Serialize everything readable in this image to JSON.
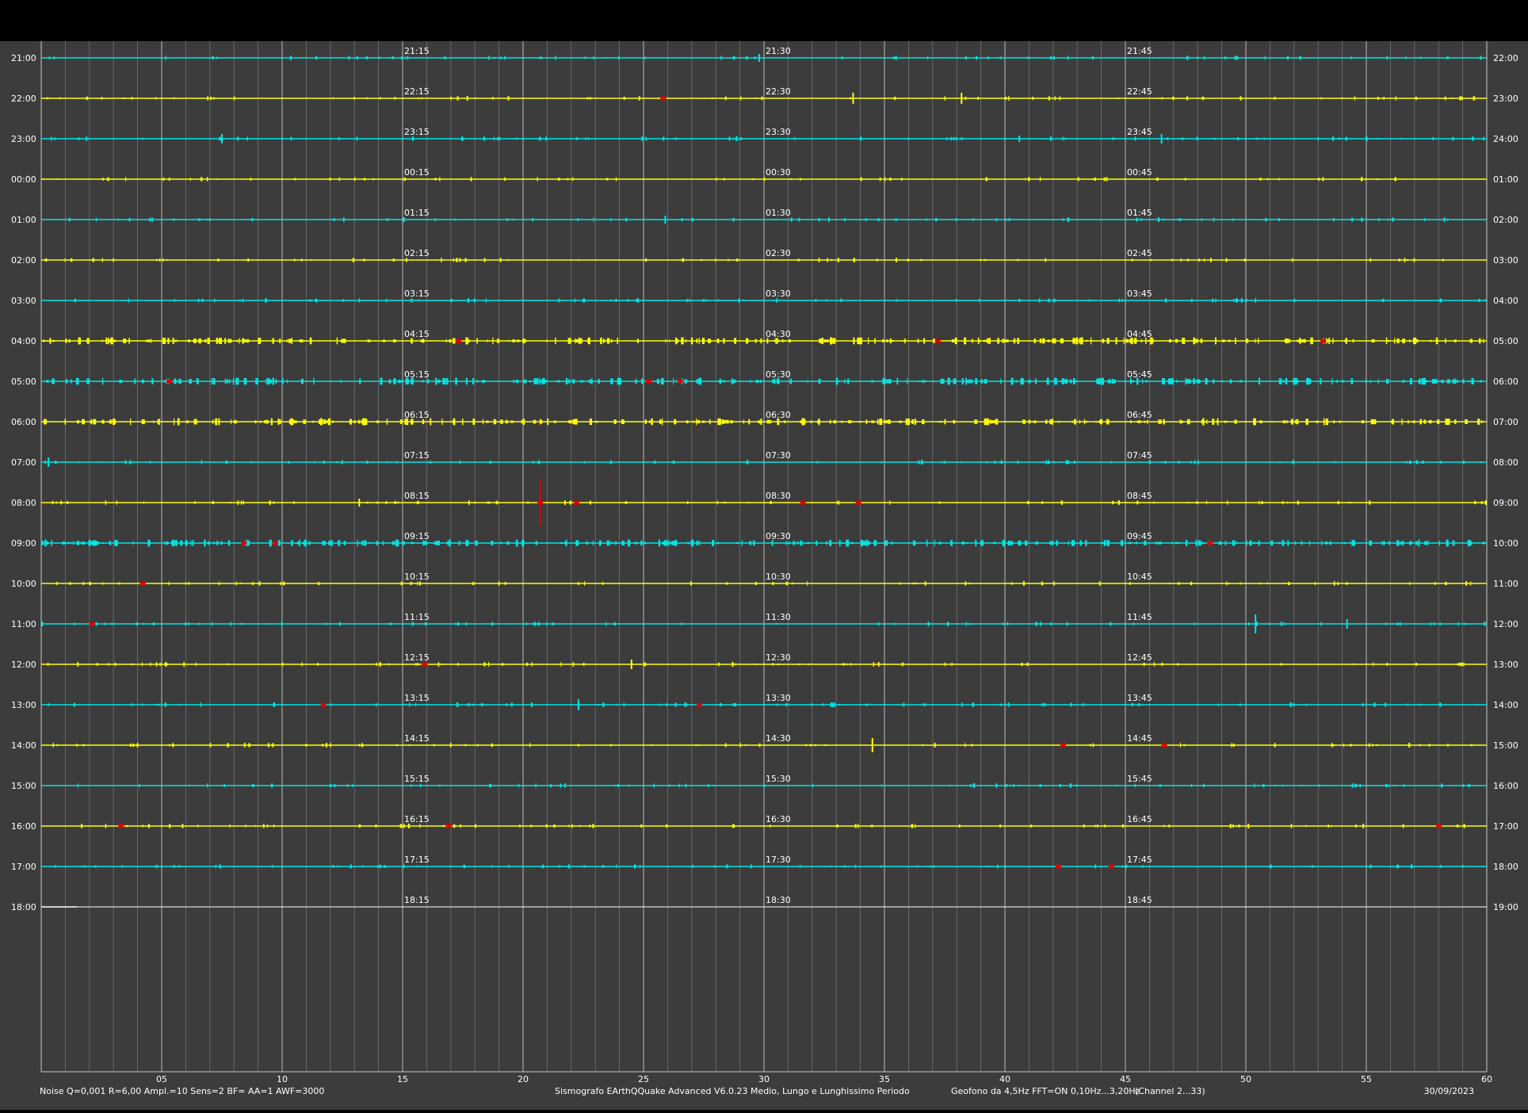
{
  "chart_data": {
    "type": "line",
    "title": "",
    "x_range": [
      0,
      60
    ],
    "x_ticks": [
      "05",
      "10",
      "15",
      "20",
      "25",
      "30",
      "35",
      "40",
      "45",
      "50",
      "55",
      "60"
    ],
    "colors": {
      "background": "#3c3c3c",
      "trace_cyan": "#00e5e5",
      "trace_yellow": "#ffff00",
      "event_red": "#e00000",
      "grid_major": "#c8c8c8",
      "grid_minor": "#8a8a8a",
      "text": "#ffffff"
    },
    "rows": [
      {
        "left": "21:00",
        "right": "22:00",
        "m15": "21:15",
        "m30": "21:30",
        "m45": "21:45",
        "color": "cyan"
      },
      {
        "left": "22:00",
        "right": "23:00",
        "m15": "22:15",
        "m30": "22:30",
        "m45": "22:45",
        "color": "yellow"
      },
      {
        "left": "23:00",
        "right": "24:00",
        "m15": "23:15",
        "m30": "23:30",
        "m45": "23:45",
        "color": "cyan"
      },
      {
        "left": "00:00",
        "right": "01:00",
        "m15": "00:15",
        "m30": "00:30",
        "m45": "00:45",
        "color": "yellow"
      },
      {
        "left": "01:00",
        "right": "02:00",
        "m15": "01:15",
        "m30": "01:30",
        "m45": "01:45",
        "color": "cyan"
      },
      {
        "left": "02:00",
        "right": "03:00",
        "m15": "02:15",
        "m30": "02:30",
        "m45": "02:45",
        "color": "yellow"
      },
      {
        "left": "03:00",
        "right": "04:00",
        "m15": "03:15",
        "m30": "03:30",
        "m45": "03:45",
        "color": "cyan"
      },
      {
        "left": "04:00",
        "right": "05:00",
        "m15": "04:15",
        "m30": "04:30",
        "m45": "04:45",
        "color": "yellow"
      },
      {
        "left": "05:00",
        "right": "06:00",
        "m15": "05:15",
        "m30": "05:30",
        "m45": "05:45",
        "color": "cyan"
      },
      {
        "left": "06:00",
        "right": "07:00",
        "m15": "06:15",
        "m30": "06:30",
        "m45": "06:45",
        "color": "yellow"
      },
      {
        "left": "07:00",
        "right": "08:00",
        "m15": "07:15",
        "m30": "07:30",
        "m45": "07:45",
        "color": "cyan"
      },
      {
        "left": "08:00",
        "right": "09:00",
        "m15": "08:15",
        "m30": "08:30",
        "m45": "08:45",
        "color": "yellow"
      },
      {
        "left": "09:00",
        "right": "10:00",
        "m15": "09:15",
        "m30": "09:30",
        "m45": "09:45",
        "color": "cyan"
      },
      {
        "left": "10:00",
        "right": "11:00",
        "m15": "10:15",
        "m30": "10:30",
        "m45": "10:45",
        "color": "yellow"
      },
      {
        "left": "11:00",
        "right": "12:00",
        "m15": "11:15",
        "m30": "11:30",
        "m45": "11:45",
        "color": "cyan"
      },
      {
        "left": "12:00",
        "right": "13:00",
        "m15": "12:15",
        "m30": "12:30",
        "m45": "12:45",
        "color": "yellow"
      },
      {
        "left": "13:00",
        "right": "14:00",
        "m15": "13:15",
        "m30": "13:30",
        "m45": "13:45",
        "color": "cyan"
      },
      {
        "left": "14:00",
        "right": "15:00",
        "m15": "14:15",
        "m30": "14:30",
        "m45": "14:45",
        "color": "yellow"
      },
      {
        "left": "15:00",
        "right": "16:00",
        "m15": "15:15",
        "m30": "15:30",
        "m45": "15:45",
        "color": "cyan"
      },
      {
        "left": "16:00",
        "right": "17:00",
        "m15": "16:15",
        "m30": "16:30",
        "m45": "16:45",
        "color": "yellow"
      },
      {
        "left": "17:00",
        "right": "18:00",
        "m15": "17:15",
        "m30": "17:30",
        "m45": "17:45",
        "color": "cyan"
      },
      {
        "left": "18:00",
        "right": "19:00",
        "m15": "18:15",
        "m30": "18:30",
        "m45": "18:45",
        "color": "white",
        "partial_until_min": 1.5
      }
    ],
    "events": [
      {
        "row": 1,
        "min": 25.8
      },
      {
        "row": 7,
        "min": 17.3
      },
      {
        "row": 7,
        "min": 37.2
      },
      {
        "row": 7,
        "min": 53.2
      },
      {
        "row": 8,
        "min": 5.3
      },
      {
        "row": 8,
        "min": 25.2
      },
      {
        "row": 8,
        "min": 26.5
      },
      {
        "row": 11,
        "min": 20.7,
        "big": true
      },
      {
        "row": 11,
        "min": 22.2
      },
      {
        "row": 11,
        "min": 31.6
      },
      {
        "row": 11,
        "min": 33.9
      },
      {
        "row": 12,
        "min": 8.4
      },
      {
        "row": 12,
        "min": 9.7
      },
      {
        "row": 12,
        "min": 48.5
      },
      {
        "row": 13,
        "min": 4.2
      },
      {
        "row": 14,
        "min": 2.1
      },
      {
        "row": 15,
        "min": 15.9
      },
      {
        "row": 16,
        "min": 11.7
      },
      {
        "row": 16,
        "min": 27.3
      },
      {
        "row": 17,
        "min": 42.4
      },
      {
        "row": 17,
        "min": 46.6
      },
      {
        "row": 19,
        "min": 3.3
      },
      {
        "row": 19,
        "min": 16.9
      },
      {
        "row": 19,
        "min": 58
      },
      {
        "row": 20,
        "min": 42.2
      },
      {
        "row": 20,
        "min": 44.4
      }
    ],
    "noisy_rows": [
      7,
      8,
      9,
      12
    ],
    "footer": {
      "left": "Noise Q=0,001 R=6,00 Ampl.=10 Sens=2 BF= AA=1 AWF=3000",
      "center": "Sismografo  EArthQQuake Advanced V6.0.23  Medio, Lungo e Lunghissimo Periodo",
      "right": "Geofono da 4,5Hz FFT=ON 0,10Hz...3,20Hz",
      "channel": "(Channel 2...33)",
      "date": "30/09/2023"
    }
  }
}
